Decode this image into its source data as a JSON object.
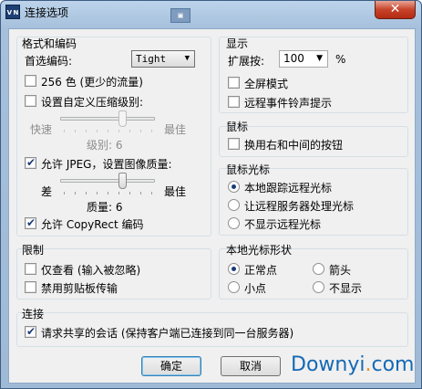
{
  "window": {
    "title": "连接选项",
    "icon": "vnc-app-icon",
    "icon_text": "V N",
    "close_glyph": "✕"
  },
  "format": {
    "title": "格式和编码",
    "preferred_label": "首选编码:",
    "preferred_value": "Tight",
    "color256_label": "256 色 (更少的流量)",
    "color256_checked": false,
    "custom_compress_label": "设置自定义压缩级别:",
    "custom_compress_checked": false,
    "compress_low": "快速",
    "compress_high": "最佳",
    "compress_level_label": "级别: 6",
    "compress_level_value": 6,
    "jpeg_label": "允许 JPEG，设置图像质量:",
    "jpeg_checked": true,
    "quality_low": "差",
    "quality_high": "最佳",
    "quality_level_label": "质量: 6",
    "quality_level_value": 6,
    "copyrect_label": "允许 CopyRect 编码",
    "copyrect_checked": true
  },
  "display": {
    "title": "显示",
    "scale_label": "扩展按:",
    "scale_value": "100",
    "scale_unit": "%",
    "fullscreen_label": "全屏模式",
    "fullscreen_checked": false,
    "bell_label": "远程事件铃声提示",
    "bell_checked": false
  },
  "mouse": {
    "title": "鼠标",
    "swap_label": "换用右和中间的按钮",
    "swap_checked": false
  },
  "cursor": {
    "title": "鼠标光标",
    "options": [
      "本地跟踪远程光标",
      "让远程服务器处理光标",
      "不显示远程光标"
    ],
    "selected": 0
  },
  "restrict": {
    "title": "限制",
    "viewonly_label": "仅查看 (输入被忽略)",
    "viewonly_checked": false,
    "clipboard_label": "禁用剪贴板传输",
    "clipboard_checked": false
  },
  "local_cursor": {
    "title": "本地光标形状",
    "options": [
      "正常点",
      "箭头",
      "小点",
      "不显示"
    ],
    "selected": 0
  },
  "connection": {
    "title": "连接",
    "shared_label": "请求共享的会话 (保持客户端已连接到同一台服务器)",
    "shared_checked": true
  },
  "buttons": {
    "ok": "确定",
    "cancel": "取消"
  },
  "watermark": {
    "part1": "Downyi",
    "dot": ".",
    "part2": "com"
  },
  "colors": {
    "accent": "#1a3a78",
    "title_bar": "#a6c0dc",
    "close": "#c7432a",
    "watermark": "#1569b4"
  }
}
